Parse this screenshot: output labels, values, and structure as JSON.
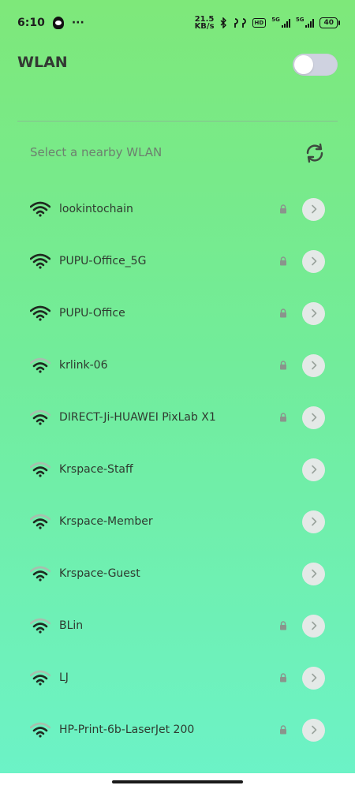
{
  "status_bar": {
    "time": "6:10",
    "dots": "···",
    "speed_top": "21.5",
    "speed_bottom": "KB/s",
    "hd": "HD",
    "net1": "5G",
    "net2": "5G",
    "battery": "40"
  },
  "header": {
    "title": "WLAN",
    "toggle_on": false
  },
  "nearby": {
    "label": "Select a nearby WLAN"
  },
  "networks": [
    {
      "ssid": "lookintochain",
      "locked": true,
      "strength": 3
    },
    {
      "ssid": "PUPU-Office_5G",
      "locked": true,
      "strength": 3
    },
    {
      "ssid": "PUPU-Office",
      "locked": true,
      "strength": 3
    },
    {
      "ssid": "krlink-06",
      "locked": true,
      "strength": 2
    },
    {
      "ssid": "DIRECT-Ji-HUAWEI PixLab X1",
      "locked": true,
      "strength": 2
    },
    {
      "ssid": "Krspace-Staff",
      "locked": false,
      "strength": 2
    },
    {
      "ssid": "Krspace-Member",
      "locked": false,
      "strength": 2
    },
    {
      "ssid": "Krspace-Guest",
      "locked": false,
      "strength": 2
    },
    {
      "ssid": "BLin",
      "locked": true,
      "strength": 2
    },
    {
      "ssid": "LJ",
      "locked": true,
      "strength": 2
    },
    {
      "ssid": "HP-Print-6b-LaserJet 200",
      "locked": true,
      "strength": 2
    }
  ],
  "colors": {
    "wifi_active": "#1f2a20",
    "wifi_dim": "#a7bfae",
    "lock": "#8a948c",
    "chevron": "#9aa39d"
  }
}
